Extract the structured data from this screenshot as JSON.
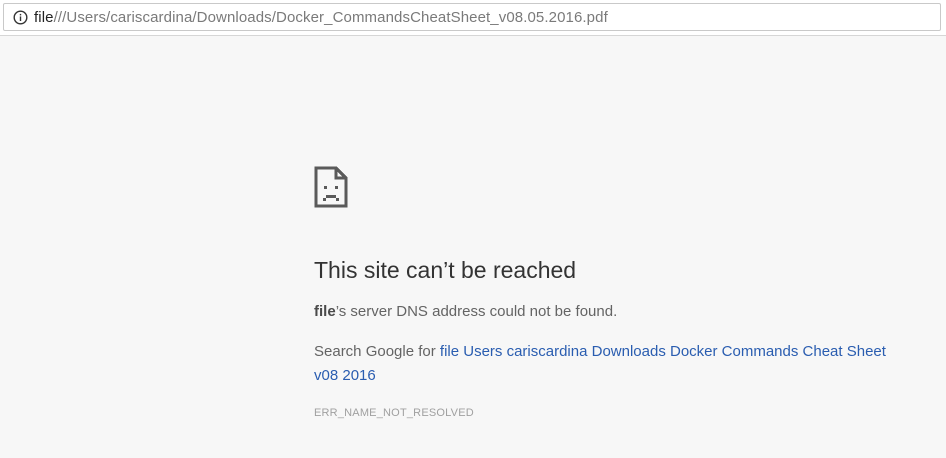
{
  "address_bar": {
    "info_icon": "info-circle-icon",
    "scheme": "file",
    "path": "///Users/cariscardina/Downloads/Docker_CommandsCheatSheet_v08.05.2016.pdf"
  },
  "error_page": {
    "icon": "sad-page-icon",
    "title": "This site can’t be reached",
    "desc_bold": "file",
    "desc_rest": "’s server DNS address could not be found.",
    "suggest_prefix": "Search Google for ",
    "suggest_link": "file Users cariscardina Downloads Docker Commands Cheat Sheet v08 2016",
    "error_code": "ERR_NAME_NOT_RESOLVED",
    "link_color": "#2a5db0"
  }
}
